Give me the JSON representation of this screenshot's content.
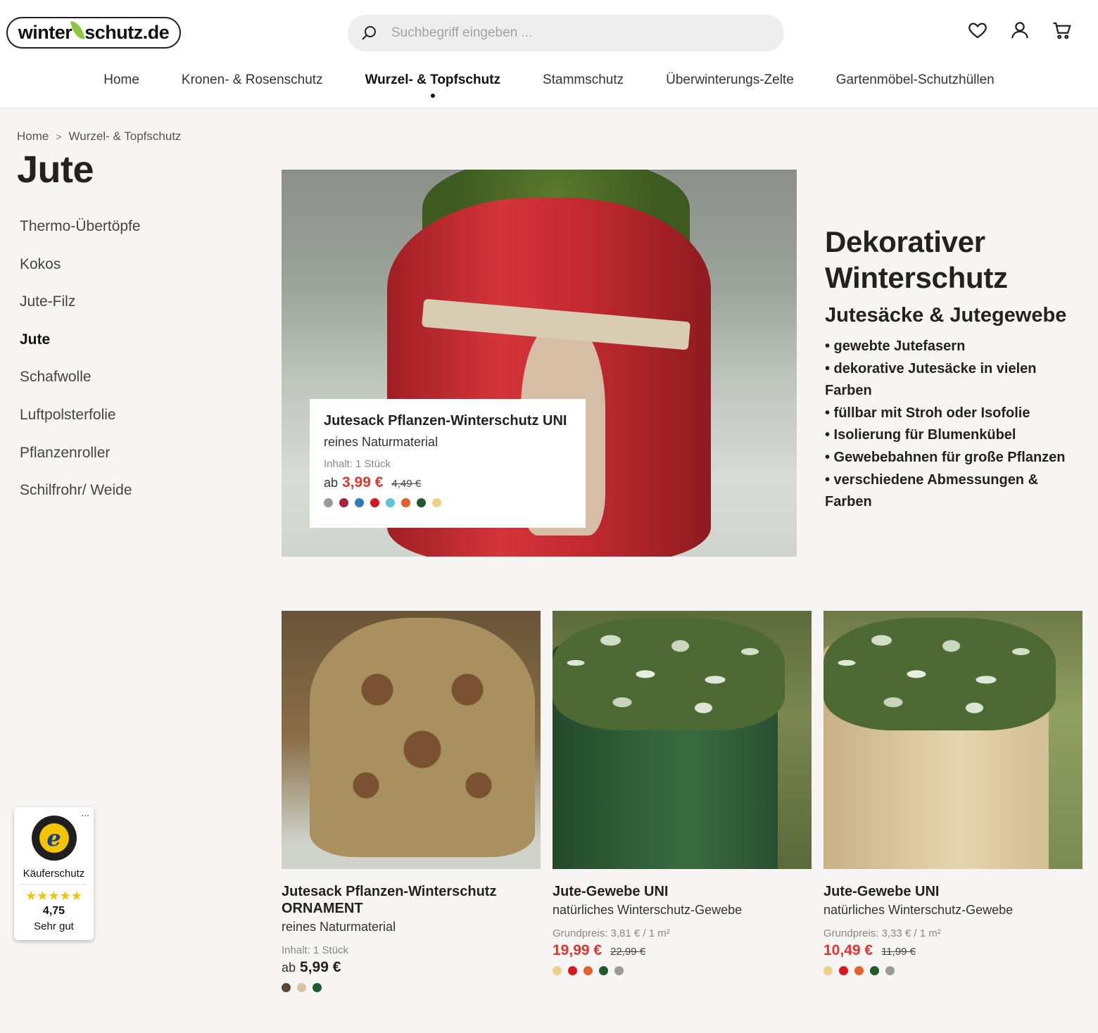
{
  "header": {
    "logo": {
      "part1": "winter",
      "part2": "schutz.de"
    },
    "search_placeholder": "Suchbegriff eingeben ...",
    "icons": [
      "heart-icon",
      "user-icon",
      "cart-icon"
    ]
  },
  "nav": [
    {
      "label": "Home",
      "active": false
    },
    {
      "label": "Kronen- & Rosenschutz",
      "active": false
    },
    {
      "label": "Wurzel- & Topfschutz",
      "active": true
    },
    {
      "label": "Stammschutz",
      "active": false
    },
    {
      "label": "Überwinterungs-Zelte",
      "active": false
    },
    {
      "label": "Gartenmöbel-Schutzhüllen",
      "active": false
    }
  ],
  "breadcrumb": {
    "home": "Home",
    "current": "Wurzel- & Topfschutz"
  },
  "page_title": "Jute",
  "sidebar": [
    {
      "label": "Thermo-Übertöpfe",
      "active": false
    },
    {
      "label": "Kokos",
      "active": false
    },
    {
      "label": "Jute-Filz",
      "active": false
    },
    {
      "label": "Jute",
      "active": true
    },
    {
      "label": "Schafwolle",
      "active": false
    },
    {
      "label": "Luftpolsterfolie",
      "active": false
    },
    {
      "label": "Pflanzenroller",
      "active": false
    },
    {
      "label": "Schilfrohr/ Weide",
      "active": false
    }
  ],
  "hero_product": {
    "title": "Jutesack Pflanzen-Winterschutz UNI",
    "subtitle": "reines Naturmaterial",
    "content": "Inhalt: 1 Stück",
    "price_prefix": "ab",
    "price": "3,99 €",
    "old_price": "4,49 €",
    "swatches": [
      "#9a9a9a",
      "#a3243b",
      "#2e7bbd",
      "#d9161e",
      "#5ec3d2",
      "#e0622a",
      "#1e5a2c",
      "#ecd089"
    ]
  },
  "promo": {
    "headline": "Dekorativer Winterschutz",
    "subheadline": "Jutesäcke & Jutegewebe",
    "bullets": [
      "• gewebte Jutefasern",
      "• dekorative Jutesäcke in vielen Farben",
      "• füllbar mit Stroh oder Isofolie",
      "• Isolierung für Blumenkübel",
      "• Gewebebahnen für große Pflanzen",
      "• verschiedene Abmessungen & Farben"
    ]
  },
  "products": [
    {
      "name": "Jutesack Pflanzen-Winterschutz ORNAMENT",
      "subtitle": "reines Naturmaterial",
      "meta": "Inhalt: 1 Stück",
      "price_prefix": "ab",
      "price": "5,99 €",
      "old_price": "",
      "swatches": [
        "#5a4636",
        "#d9c3a3",
        "#1e5a2c"
      ]
    },
    {
      "name": "Jute-Gewebe UNI",
      "subtitle": "natürliches Winterschutz-Gewebe",
      "meta": "Grundpreis: 3,81 € / 1 m²",
      "price_prefix": "",
      "price": "19,99 €",
      "old_price": "22,99 €",
      "swatches": [
        "#ecd089",
        "#d9161e",
        "#e0622a",
        "#1e5a2c",
        "#9a9a9a"
      ]
    },
    {
      "name": "Jute-Gewebe UNI",
      "subtitle": "natürliches Winterschutz-Gewebe",
      "meta": "Grundpreis: 3,33 € / 1 m²",
      "price_prefix": "",
      "price": "10,49 €",
      "old_price": "11,99 €",
      "swatches": [
        "#ecd089",
        "#d9161e",
        "#e0622a",
        "#1e5a2c",
        "#9a9a9a"
      ]
    }
  ],
  "trust_badge": {
    "label": "Käuferschutz",
    "stars": "★★★★★",
    "score": "4,75",
    "grade": "Sehr gut",
    "menu": "..."
  },
  "colors": {
    "price_red": "#e0342f",
    "accent_green": "#8cc63f"
  }
}
